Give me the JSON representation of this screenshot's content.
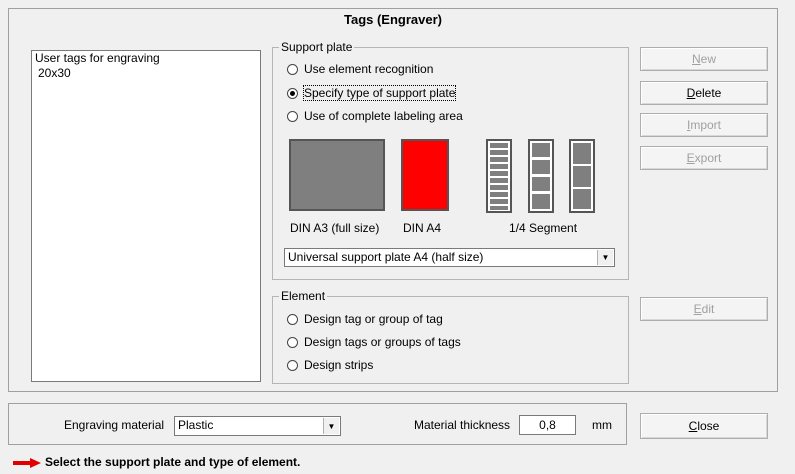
{
  "window": {
    "title": "Tags (Engraver)"
  },
  "tag_list": {
    "header": "User tags for engraving",
    "items": [
      "20x30"
    ]
  },
  "support_plate": {
    "label": "Support plate",
    "options": [
      "Use element recognition",
      "Specify type of support plate",
      "Use of complete labeling area"
    ],
    "selected_index": 1,
    "plates": {
      "a3_label": "DIN A3 (full size)",
      "a4_label": "DIN A4",
      "segment_label": "1/4 Segment",
      "a3_color": "#7f7f7f",
      "a4_color": "#ff0000"
    },
    "dropdown_value": "Universal support plate A4 (half size)"
  },
  "element": {
    "label": "Element",
    "options": [
      "Design tag or group of tag",
      "Design tags or groups of tags",
      "Design strips"
    ]
  },
  "buttons": {
    "new": {
      "label": "New",
      "mnemonic": "N",
      "rest": "ew",
      "enabled": false
    },
    "delete": {
      "label": "Delete",
      "mnemonic": "D",
      "rest": "elete",
      "enabled": true
    },
    "import": {
      "label": "Import",
      "mnemonic": "I",
      "rest": "mport",
      "enabled": false
    },
    "export": {
      "label": "Export",
      "mnemonic": "E",
      "rest": "xport",
      "enabled": false
    },
    "edit": {
      "label": "Edit",
      "mnemonic": "E",
      "rest": "dit",
      "enabled": false
    },
    "close": {
      "label": "Close",
      "mnemonic": "C",
      "rest": "lose",
      "enabled": true
    }
  },
  "material": {
    "engraving_label": "Engraving material",
    "engraving_value": "Plastic",
    "thickness_label": "Material thickness",
    "thickness_value": "0,8",
    "unit": "mm"
  },
  "status": {
    "text": "Select the support plate and type of element.",
    "arrow_color": "#e00000"
  }
}
